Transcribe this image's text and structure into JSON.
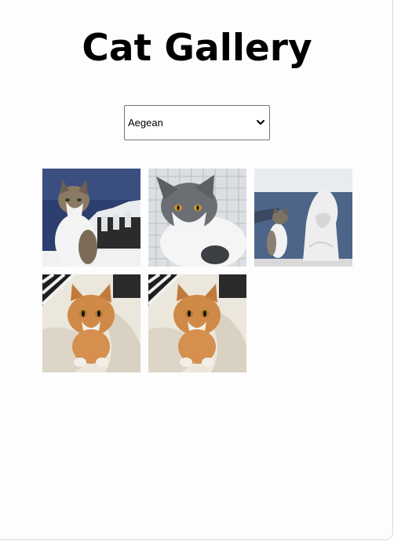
{
  "page": {
    "title": "Cat Gallery"
  },
  "breed_select": {
    "selected": "Aegean"
  },
  "gallery": {
    "images": [
      {
        "subject": "tabby-white cat sitting by sea with white houses"
      },
      {
        "subject": "grey and white cat on net"
      },
      {
        "subject": "grey cat beside white snow sculpture overlooking sea"
      },
      {
        "subject": "orange tabby cat lying on white pillows"
      },
      {
        "subject": "orange tabby cat lying on white pillows"
      }
    ]
  },
  "colors": {
    "background": "#fdfdfd",
    "text": "#000000",
    "select_border": "#767676"
  }
}
